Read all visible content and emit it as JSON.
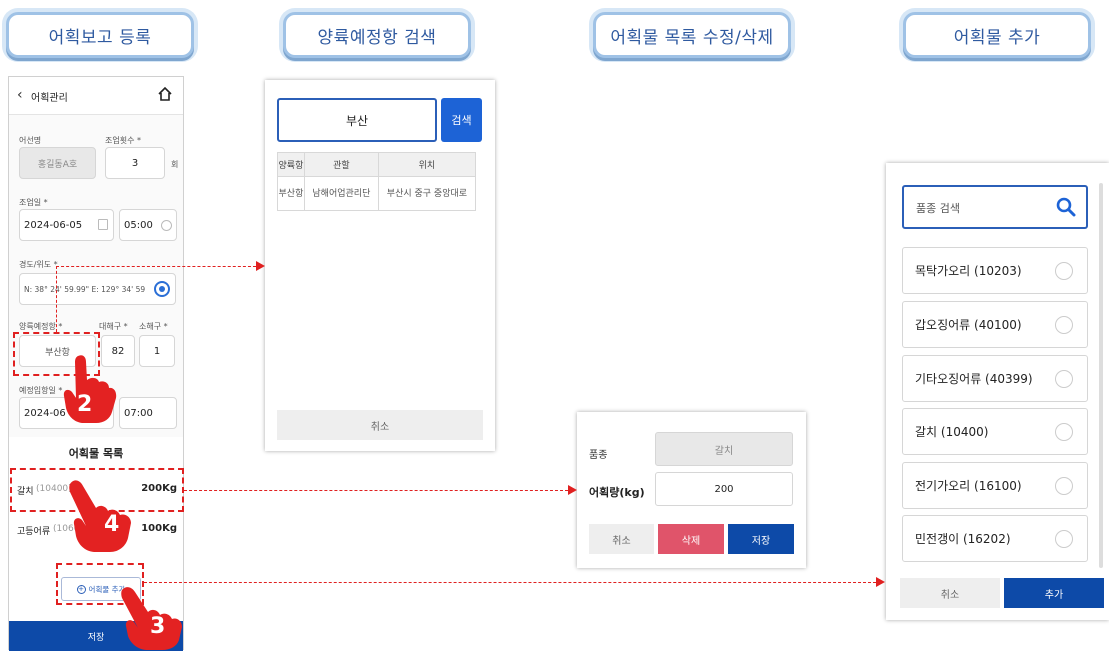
{
  "headers": {
    "step1": "어획보고 등록",
    "step2": "양륙예정항 검색",
    "step3": "어획물 목록 수정/삭제",
    "step4": "어획물 추가"
  },
  "catch_form": {
    "back_label": "어획관리",
    "vessel_label": "어선명",
    "vessel_value": "홍길동A호",
    "ops_count_label": "조업횟수 *",
    "ops_count_value": "3",
    "ops_count_unit": "회",
    "date_label": "조업일 *",
    "date_value": "2024-06-05",
    "time_value": "05:00",
    "coord_label": "경도/위도 *",
    "coord_value": "N: 38° 24' 59.99\" E: 129° 34' 59",
    "port_label": "양륙예정항 *",
    "port_value": "부산항",
    "zone_large_label": "대해구 *",
    "zone_large_value": "82",
    "zone_small_label": "소해구 *",
    "zone_small_value": "1",
    "entry_label": "예정입항일 *",
    "entry_date_value": "2024-06",
    "entry_time_value": "07:00",
    "list_title": "어획물 목록",
    "catch_items": [
      {
        "name": "갈치",
        "code": "(10400)",
        "weight": "200Kg"
      },
      {
        "name": "고등어류",
        "code": "(10600)",
        "weight": "100Kg"
      }
    ],
    "add_button": "어획물 추가",
    "save_button": "저장"
  },
  "port_search": {
    "search_value": "부산",
    "search_button": "검색",
    "columns": [
      "양륙항",
      "관할",
      "위치"
    ],
    "rows": [
      [
        "부산항",
        "남해어업관리단",
        "부산시 중구 중앙대로"
      ]
    ],
    "cancel_button": "취소"
  },
  "catch_edit": {
    "species_label": "품종",
    "species_value": "갈치",
    "amount_label": "어획량(kg)",
    "amount_value": "200",
    "cancel_button": "취소",
    "delete_button": "삭제",
    "save_button": "저장"
  },
  "catch_add": {
    "search_placeholder": "품종 검색",
    "items": [
      "목탁가오리 (10203)",
      "갑오징어류 (40100)",
      "기타오징어류 (40399)",
      "갈치 (10400)",
      "전기가오리 (16100)",
      "민전갱이 (16202)"
    ],
    "cancel_button": "취소",
    "add_button": "추가"
  },
  "steps": [
    "2",
    "4",
    "3"
  ],
  "colors": {
    "primary": "#0d4aa8",
    "delete": "#e0546a",
    "annotation": "#e02020",
    "header_border": "#9fc2e6"
  }
}
